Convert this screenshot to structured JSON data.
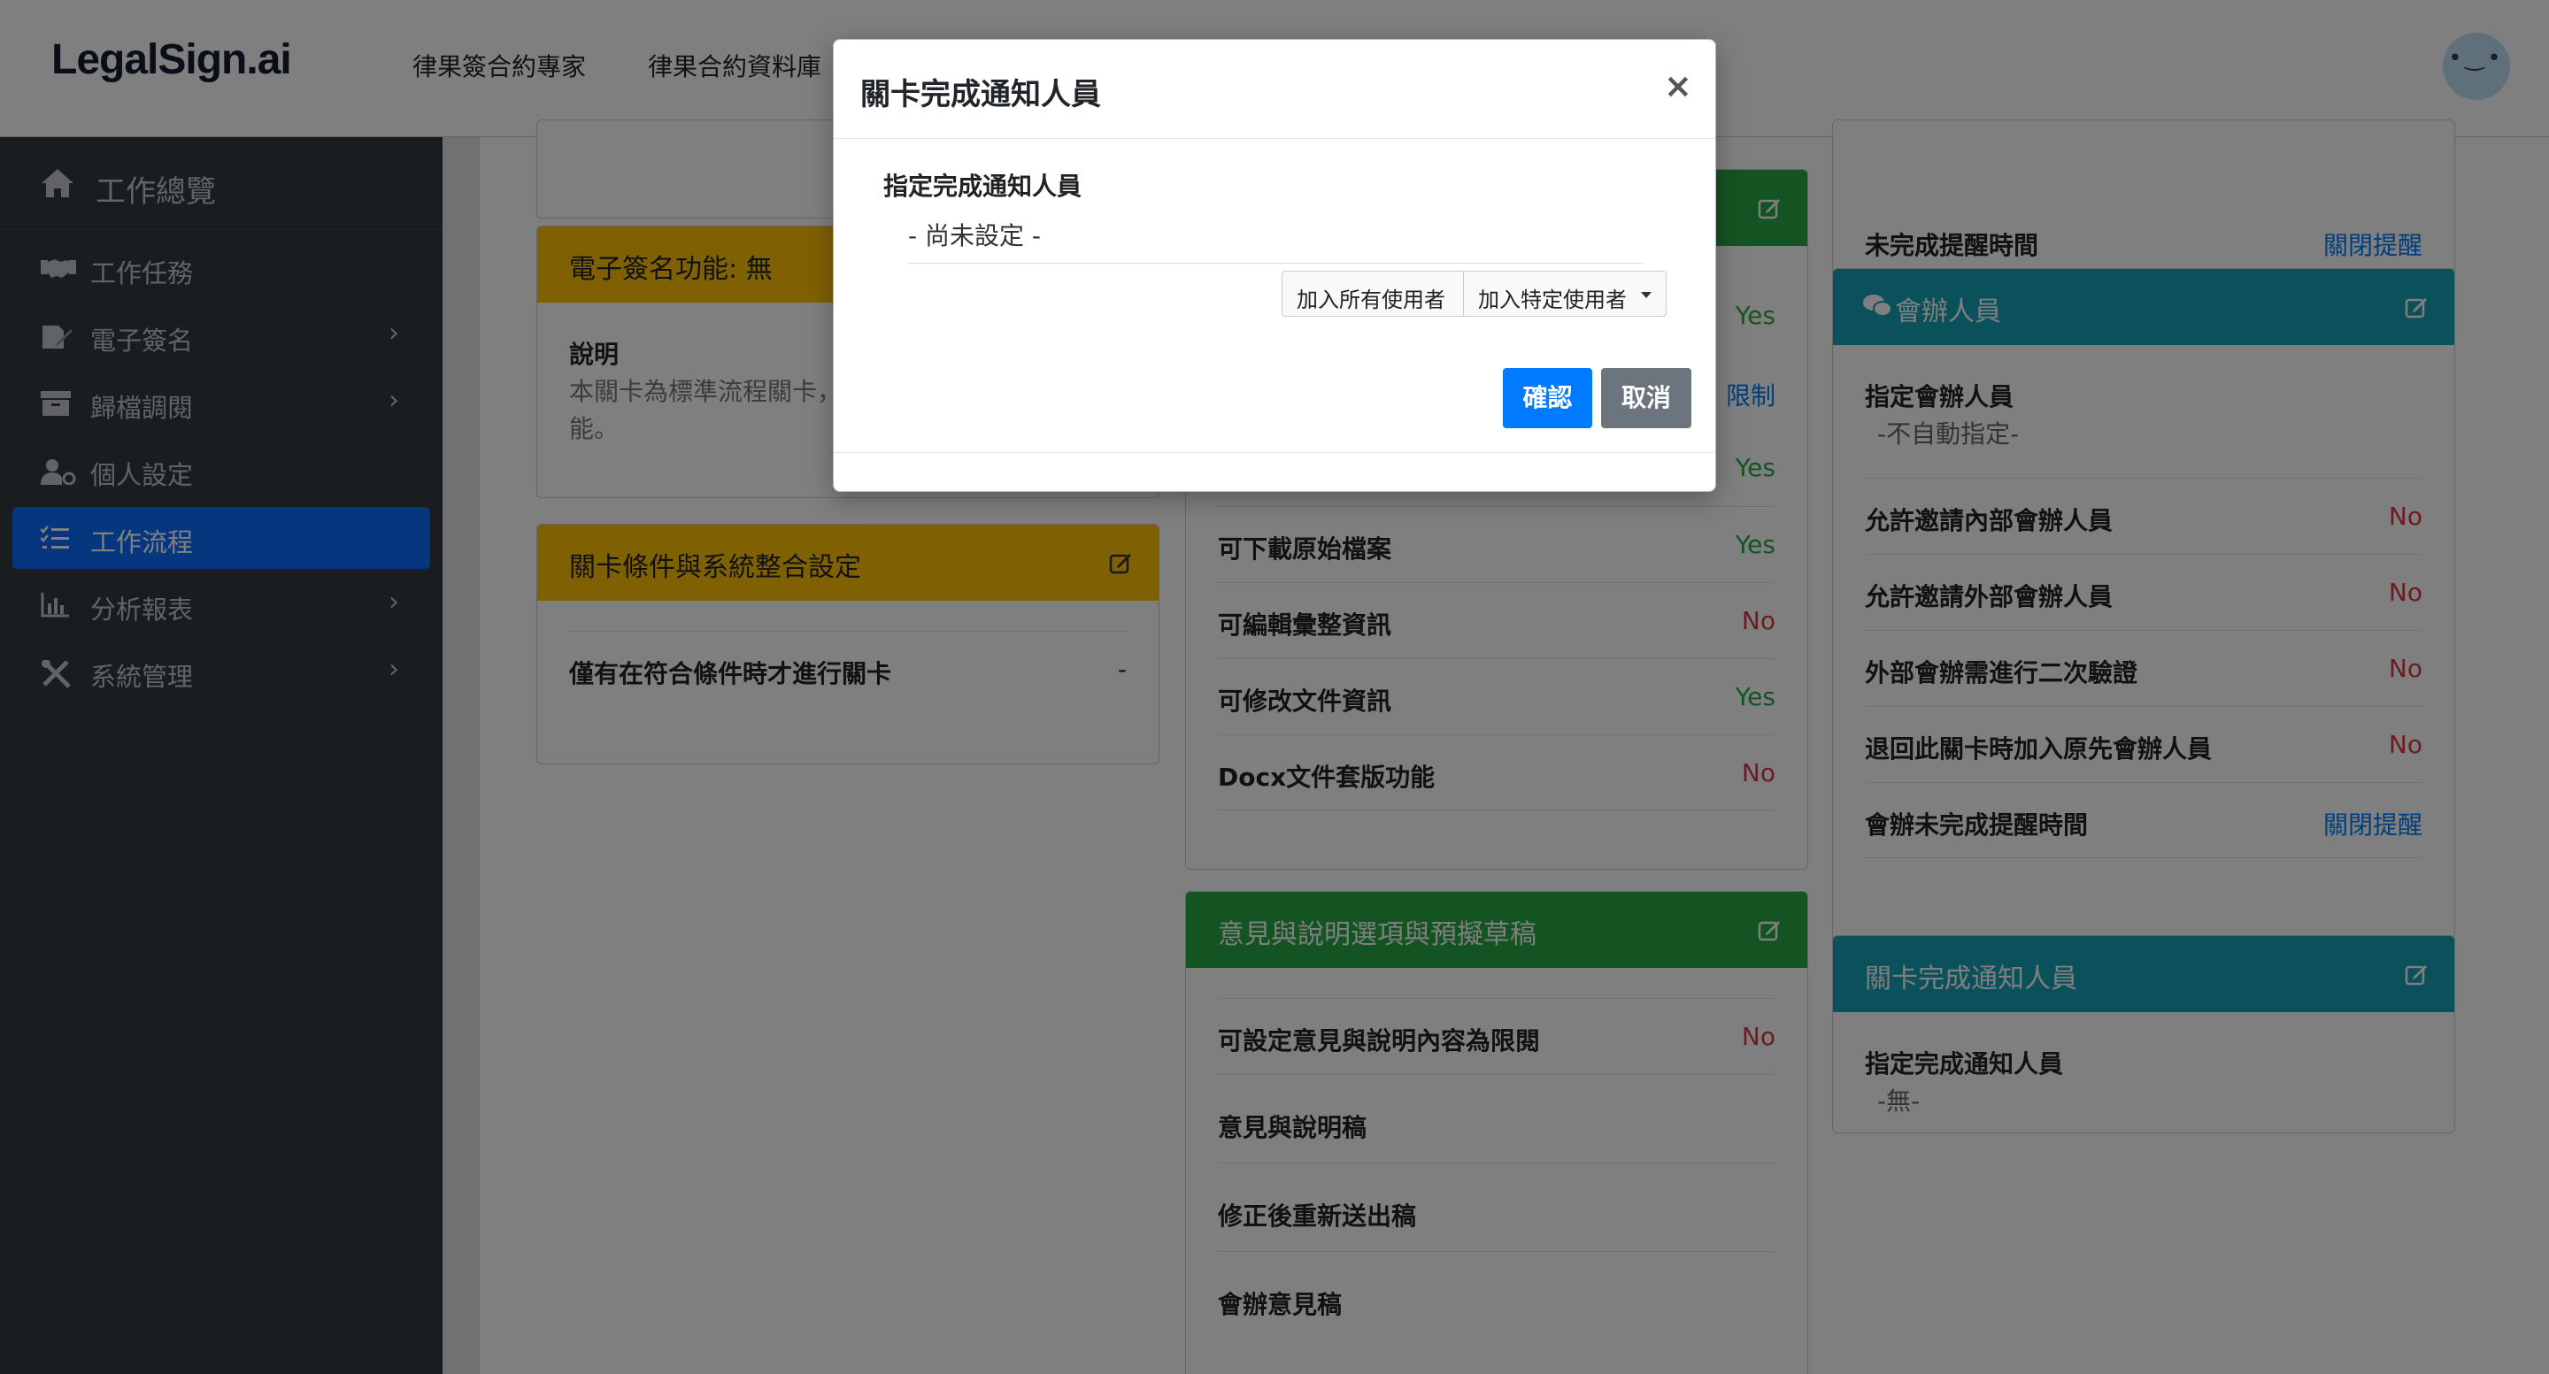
{
  "header": {
    "brand": "LegalSign.ai",
    "nav": [
      "律果簽合約專家",
      "律果合約資料庫"
    ]
  },
  "sidebar": {
    "title": "工作總覽",
    "items": [
      {
        "label": "工作任務",
        "icon": "handshake-icon",
        "chevron": false
      },
      {
        "label": "電子簽名",
        "icon": "signature-icon",
        "chevron": true
      },
      {
        "label": "歸檔調閱",
        "icon": "archive-icon",
        "chevron": true
      },
      {
        "label": "個人設定",
        "icon": "user-cog-icon",
        "chevron": false
      },
      {
        "label": "工作流程",
        "icon": "tasks-icon",
        "chevron": false,
        "active": true
      },
      {
        "label": "分析報表",
        "icon": "chart-icon",
        "chevron": true
      },
      {
        "label": "系統管理",
        "icon": "tools-icon",
        "chevron": true
      }
    ]
  },
  "esign_card": {
    "title": "電子簽名功能: 無",
    "desc_label": "說明",
    "desc_line1": "本關卡為標準流程關卡，",
    "desc_line2": "能。"
  },
  "condition_card": {
    "title": "關卡條件與系統整合設定",
    "row_label": "僅有在符合條件時才進行關卡",
    "row_value": "-"
  },
  "perm_card": {
    "partial_yes1": "Yes",
    "partial_limit": "限制",
    "partial_yes2": "Yes",
    "rows": [
      {
        "label": "可下載原始檔案",
        "value": "Yes"
      },
      {
        "label": "可編輯彙整資訊",
        "value": "No"
      },
      {
        "label": "可修改文件資訊",
        "value": "Yes"
      },
      {
        "label": "Docx文件套版功能",
        "value": "No"
      }
    ]
  },
  "opinion_card": {
    "title": "意見與說明選項與預擬草稿",
    "rows": [
      {
        "label": "可設定意見與說明內容為限閱",
        "value": "No"
      },
      {
        "label": "意見與說明稿",
        "value": ""
      },
      {
        "label": "修正後重新送出稿",
        "value": ""
      },
      {
        "label": "會辦意見稿",
        "value": ""
      }
    ]
  },
  "reminder_card": {
    "label": "未完成提醒時間",
    "value": "關閉提醒"
  },
  "cosign_card": {
    "title": "會辦人員",
    "assign_label": "指定會辦人員",
    "assign_value": "-不自動指定-",
    "rows": [
      {
        "label": "允許邀請內部會辦人員",
        "value": "No"
      },
      {
        "label": "允許邀請外部會辦人員",
        "value": "No"
      },
      {
        "label": "外部會辦需進行二次驗證",
        "value": "No"
      },
      {
        "label": "退回此關卡時加入原先會辦人員",
        "value": "No"
      },
      {
        "label": "會辦未完成提醒時間",
        "value": "關閉提醒"
      }
    ]
  },
  "notify_card": {
    "title": "關卡完成通知人員",
    "label": "指定完成通知人員",
    "value": "-無-"
  },
  "modal": {
    "title": "關卡完成通知人員",
    "close": "×",
    "field_label": "指定完成通知人員",
    "field_value": "- 尚未設定 -",
    "add_all": "加入所有使用者",
    "add_specific": "加入特定使用者",
    "confirm": "確認",
    "cancel": "取消"
  },
  "colors": {
    "primary": "#007bff",
    "gold": "#ffc107",
    "green": "#28a745",
    "teal": "#17a2b8",
    "sidebar": "#343a40",
    "no": "#dc3545"
  }
}
